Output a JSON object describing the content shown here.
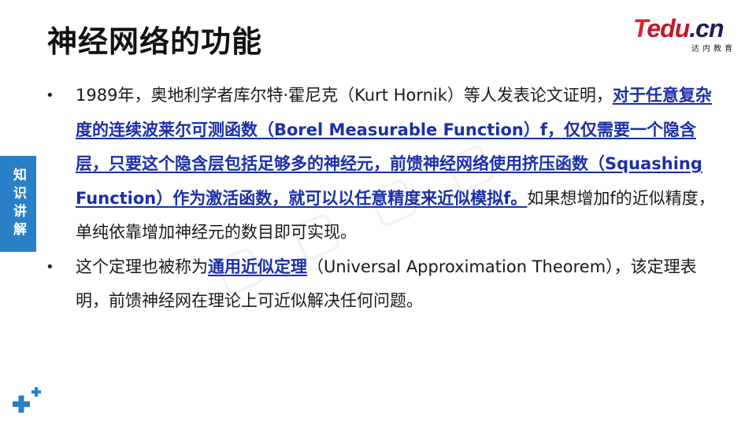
{
  "header": {
    "title": "神经网络的功能"
  },
  "logo": {
    "brand_t": "T",
    "brand_rest": "edu",
    "brand_cn": ".cn",
    "subtitle": "达内教育"
  },
  "side_tab": {
    "label": "知识讲解"
  },
  "bullets": [
    {
      "pre": "1989年，奥地利学者库尔特·霍尼克（Kurt Hornik）等人发表论文证明，",
      "highlight": "对于任意复杂度的连续波莱尔可测函数（Borel Measurable Function）f，仅仅需要一个隐含层，只要这个隐含层包括足够多的神经元，前馈神经网络使用挤压函数（Squashing Function）作为激活函数，就可以以任意精度来近似模拟f。",
      "post": "如果想增加f的近似精度，单纯依靠增加神经元的数目即可实现。"
    },
    {
      "pre": "这个定理也被称为",
      "highlight": "通用近似定理",
      "post": "（Universal Approximation Theorem），该定理表明，前馈神经网在理论上可近似解决任何问题。"
    }
  ],
  "bullet_glyph": "•",
  "colors": {
    "accent_blue": "#2a7fc6",
    "highlight_text": "#1b2fa8",
    "logo_red": "#c4162b",
    "logo_navy": "#1e1e5a"
  },
  "decor": {
    "corner_icon": "plus-icon"
  }
}
